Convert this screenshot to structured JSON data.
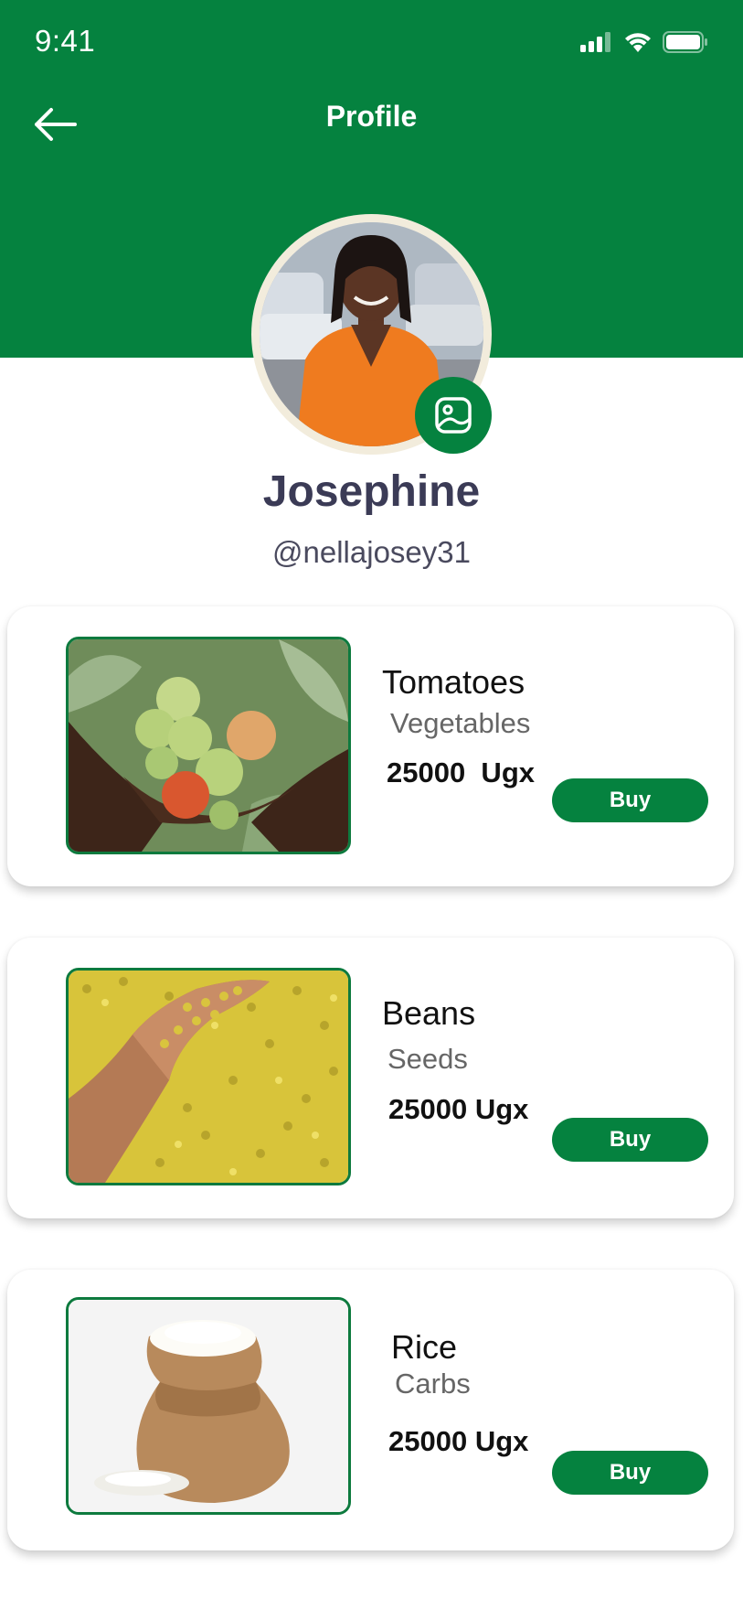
{
  "status_bar": {
    "time": "9:41",
    "signal_icon": "cellular-signal-icon",
    "wifi_icon": "wifi-icon",
    "battery_icon": "battery-icon"
  },
  "header": {
    "title": "Profile",
    "back_icon": "arrow-left-icon",
    "background_color": "#05823f"
  },
  "profile": {
    "name": "Josephine",
    "handle": "@nellajosey31",
    "edit_photo_icon": "image-icon"
  },
  "products": [
    {
      "name": "Tomatoes",
      "category": "Vegetables",
      "price": "25000  Ugx",
      "buy_label": "Buy"
    },
    {
      "name": "Beans",
      "category": "Seeds",
      "price": "25000 Ugx",
      "buy_label": "Buy"
    },
    {
      "name": "Rice",
      "category": "Carbs",
      "price": "25000 Ugx",
      "buy_label": "Buy"
    }
  ],
  "colors": {
    "accent": "#05823f",
    "name_text": "#3b3b56"
  }
}
